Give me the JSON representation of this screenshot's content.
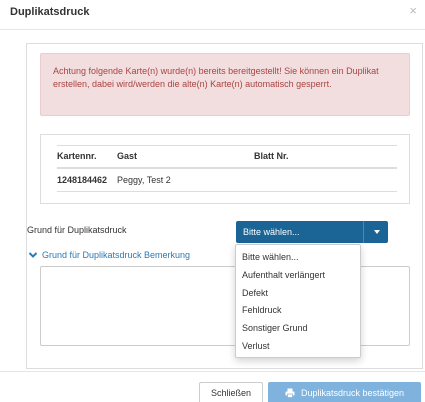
{
  "modal": {
    "title": "Duplikatsdruck",
    "close_symbol": "×"
  },
  "alert": {
    "text": "Achtung folgende Karte(n) wurde(n) bereits bereitgestellt! Sie können ein Duplikat erstellen, dabei wird/werden die alte(n) Karte(n) automatisch gesperrt."
  },
  "table": {
    "headers": [
      "Kartennr.",
      "Gast",
      "Blatt Nr."
    ],
    "rows": [
      [
        "1248184462",
        "Peggy, Test 2",
        ""
      ]
    ]
  },
  "reason": {
    "label": "Grund für Duplikatsdruck",
    "selected": "Bitte wählen...",
    "options": [
      "Bitte wählen...",
      "Aufenthalt verlängert",
      "Defekt",
      "Fehldruck",
      "Sonstiger Grund",
      "Verlust"
    ]
  },
  "remark": {
    "toggle_label": "Grund für Duplikatsdruck Bemerkung",
    "value": ""
  },
  "footer": {
    "close_label": "Schließen",
    "confirm_label": "Duplikatsdruck bestätigen"
  },
  "colors": {
    "select_bg": "#1a6496",
    "confirm_bg": "#7fb3dd",
    "alert_bg": "#f2dede",
    "alert_text": "#a94442",
    "link": "#2a7ab8"
  },
  "icons": {
    "close": "close-icon",
    "caret": "caret-down-icon",
    "chevron": "chevron-down-icon",
    "printer": "printer-icon"
  }
}
